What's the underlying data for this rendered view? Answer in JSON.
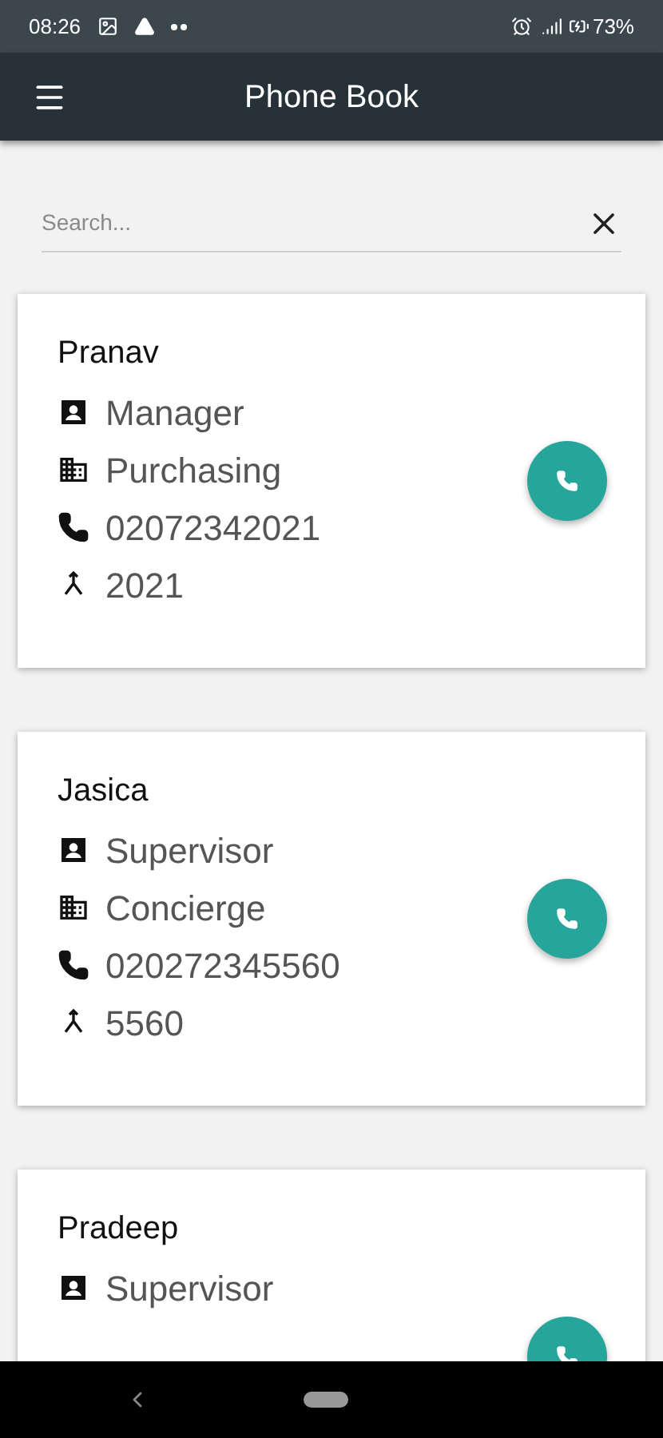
{
  "status_bar": {
    "time": "08:26",
    "battery": "73%"
  },
  "app_bar": {
    "title": "Phone Book"
  },
  "search": {
    "placeholder": "Search..."
  },
  "contacts": [
    {
      "name": "Pranav",
      "rows": [
        {
          "kind": "role",
          "text": "Manager"
        },
        {
          "kind": "department",
          "text": "Purchasing"
        },
        {
          "kind": "phone",
          "text": "02072342021"
        },
        {
          "kind": "extension",
          "text": "2021"
        }
      ]
    },
    {
      "name": "Jasica",
      "rows": [
        {
          "kind": "role",
          "text": "Supervisor"
        },
        {
          "kind": "department",
          "text": "Concierge"
        },
        {
          "kind": "phone",
          "text": "020272345560"
        },
        {
          "kind": "extension",
          "text": "5560"
        }
      ]
    },
    {
      "name": "Pradeep",
      "rows": [
        {
          "kind": "role",
          "text": "Supervisor"
        }
      ]
    }
  ]
}
